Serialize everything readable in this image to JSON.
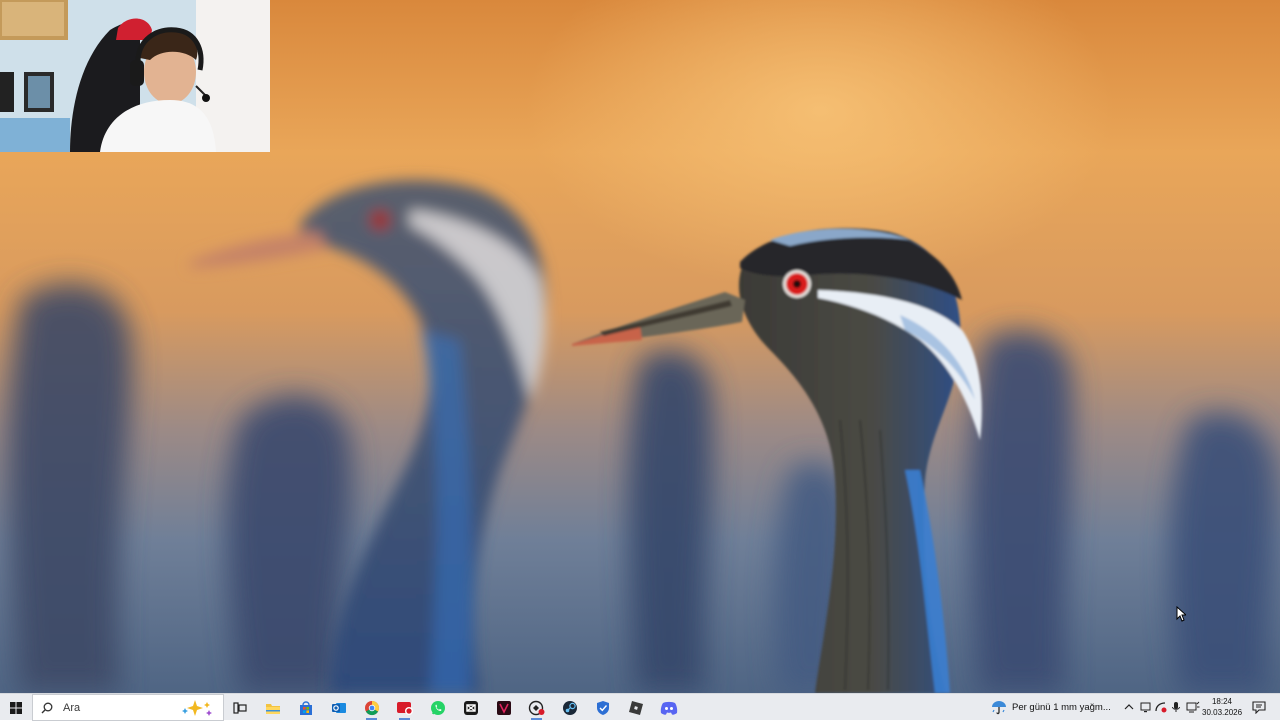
{
  "taskbar": {
    "search_placeholder": "Ara",
    "weather_text": "Per günü 1 mm yağm...",
    "clock_time": "18:24",
    "clock_date": "30.03.2026",
    "apps": [
      {
        "name": "task-view-icon"
      },
      {
        "name": "file-explorer-icon"
      },
      {
        "name": "microsoft-store-icon"
      },
      {
        "name": "outlook-icon"
      },
      {
        "name": "chrome-icon"
      },
      {
        "name": "screen-recorder-icon"
      },
      {
        "name": "whatsapp-icon"
      },
      {
        "name": "capcut-icon"
      },
      {
        "name": "media-app-icon"
      },
      {
        "name": "game-app-icon"
      },
      {
        "name": "steam-icon"
      },
      {
        "name": "security-shield-icon"
      },
      {
        "name": "roblox-icon"
      },
      {
        "name": "discord-icon"
      }
    ],
    "tray_icons": [
      "show-hidden-icons-icon",
      "display-icon",
      "network-icon",
      "volume-icon",
      "microphone-icon",
      "wifi-icon",
      "notifications-icon"
    ]
  },
  "colors": {
    "taskbar_bg": "#e9ebef",
    "wallpaper_sky": "#e9a659",
    "bird_eye": "#d91a1a",
    "beak": "#c8644a"
  }
}
